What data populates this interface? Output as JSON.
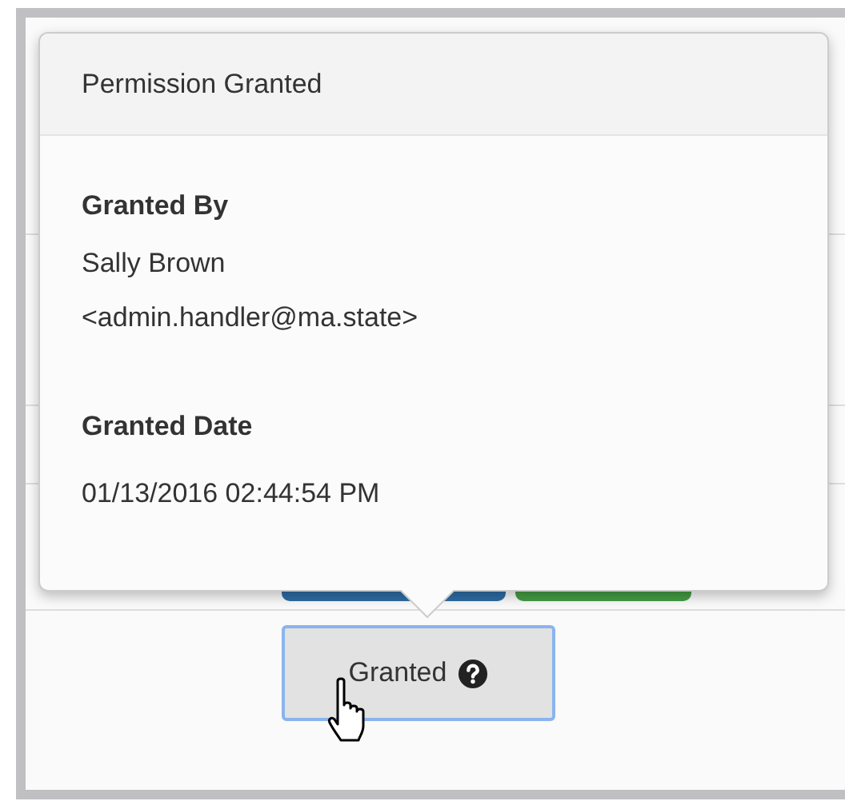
{
  "popover": {
    "title": "Permission Granted",
    "sections": [
      {
        "label": "Granted By",
        "lines": [
          "Sally Brown",
          "<admin.handler@ma.state>"
        ]
      },
      {
        "label": "Granted Date",
        "lines": [
          "01/13/2016 02:44:54 PM"
        ]
      }
    ]
  },
  "hidden_buttons": [
    {
      "color": "#2e6da4"
    },
    {
      "color": "#449d44"
    }
  ],
  "status_button": {
    "label": "Granted",
    "focused": true
  }
}
